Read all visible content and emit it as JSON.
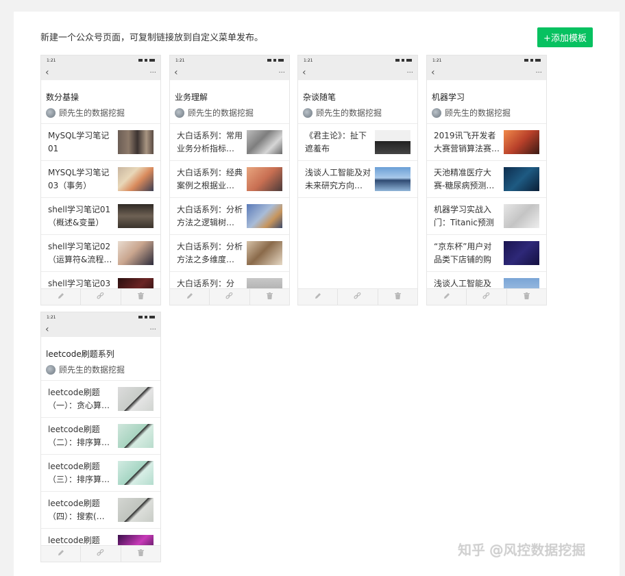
{
  "header": {
    "description": "新建一个公众号页面，可复制链接放到自定义菜单发布。",
    "add_button": "+添加模板"
  },
  "phone": {
    "time": "1:21",
    "back_icon": "‹",
    "more_icon": "···"
  },
  "toolbar": {
    "edit_icon": "pencil-icon",
    "link_icon": "link-icon",
    "delete_icon": "trash-icon"
  },
  "cards": [
    {
      "title": "数分基操",
      "author": "顾先生的数据挖掘",
      "articles": [
        {
          "text": "MySQL学习笔记01",
          "thumb": "linear-gradient(90deg,#6b5d55 0%,#8d7a6a 30%,#3b3230 55%,#a89582 80%,#5a4a42 100%)"
        },
        {
          "text": "MYSQL学习笔记03（事务）",
          "thumb": "linear-gradient(135deg,#c9b6a0 0%,#e8d7b8 35%,#d98a5c 60%,#3a3d52 100%)"
        },
        {
          "text": "shell学习笔记01（概述&变量）",
          "thumb": "linear-gradient(180deg,#2f2a25 0%,#6e6154 50%,#3a332c 100%)"
        },
        {
          "text": "shell学习笔记02（运算符&流程…",
          "thumb": "linear-gradient(135deg,#e9dcd0 0%,#c9a58e 45%,#2b2b3a 100%)"
        },
        {
          "text": "shell学习笔记03",
          "thumb": "linear-gradient(135deg,#2b1010 0%,#6a2525 50%,#1a0a0a 100%)"
        }
      ]
    },
    {
      "title": "业务理解",
      "author": "顾先生的数据挖掘",
      "articles": [
        {
          "text": "大白话系列：常用业务分析指标…",
          "thumb": "linear-gradient(135deg,#bdbdbd 0%,#7e7e7e 40%,#d6d6d6 70%,#6b6b6b 100%)"
        },
        {
          "text": "大白话系列：经典案例之根据业…",
          "thumb": "linear-gradient(135deg,#e8a57e 0%,#c86f52 50%,#4a3a3a 100%)"
        },
        {
          "text": "大白话系列：分析方法之逻辑树…",
          "thumb": "linear-gradient(135deg,#5a7ab8 0%,#a8bcd8 45%,#c7955c 70%,#3d4a6a 100%)"
        },
        {
          "text": "大白话系列：分析方法之多维度…",
          "thumb": "linear-gradient(135deg,#d6c2a8 0%,#8a6a4a 45%,#e6d8c4 100%)"
        },
        {
          "text": "大白话系列：分",
          "thumb": "linear-gradient(180deg,#c8c8c8 0%,#9a9a9a 100%)"
        }
      ]
    },
    {
      "title": "杂谈随笔",
      "author": "顾先生的数据挖掘",
      "articles": [
        {
          "text": "《君主论》：扯下遮羞布",
          "thumb": "linear-gradient(180deg,#f0f0f0 0%,#f0f0f0 45%,#222 46%,#444 100%)"
        },
        {
          "text": "浅谈人工智能及对未来研究方向…",
          "thumb": "linear-gradient(180deg,#6a9fd6 0%,#a9c9ea 45%,#2f4a72 55%,#8fb4d8 100%)"
        }
      ]
    },
    {
      "title": "机器学习",
      "author": "顾先生的数据挖掘",
      "articles": [
        {
          "text": "2019讯飞开发者大赛营销算法赛…",
          "thumb": "linear-gradient(135deg,#f08a4a 0%,#b8402a 50%,#3a1a14 100%)"
        },
        {
          "text": "天池精准医疗大赛-糖尿病预测…",
          "thumb": "linear-gradient(135deg,#0e2e4e 0%,#1e5a82 50%,#0a1e36 100%)"
        },
        {
          "text": "机器学习实战入门：Titanic预测",
          "thumb": "linear-gradient(135deg,#e6e6e6 0%,#c4c4c4 50%,#eeeeee 100%)"
        },
        {
          "text": "“京东杯”用户对品类下店铺的购买…",
          "thumb": "linear-gradient(135deg,#1a1450 0%,#2e2878 50%,#141040 100%)"
        },
        {
          "text": "浅谈人工智能及",
          "thumb": "linear-gradient(180deg,#7aa5d6 0%,#b5cde8 100%)"
        }
      ]
    },
    {
      "title": "leetcode刷题系列",
      "author": "顾先生的数据挖掘",
      "articles": [
        {
          "text": "leetcode刷题（一）：贪心算…",
          "thumb": "linear-gradient(135deg,#dcdcdc 0%,#c8ccc8 50%,#2a2a2a 51%,#e4e4e4 60%,#d0d4d0 100%)"
        },
        {
          "text": "leetcode刷题（二）：排序算…",
          "thumb": "linear-gradient(135deg,#cfe6dc 0%,#a8d4c0 50%,#2a2a2a 51%,#d6ece2 60%,#b8dccc 100%)"
        },
        {
          "text": "leetcode刷题（三）：排序算…",
          "thumb": "linear-gradient(135deg,#d2ebe2 0%,#a6d6c4 50%,#2a2a2a 51%,#d8eee6 60%,#b4ddce 100%)"
        },
        {
          "text": "leetcode刷题（四）：搜索(…",
          "thumb": "linear-gradient(135deg,#d4d6d2 0%,#c0c4be 50%,#2a2a2a 51%,#dcdedA 60%,#c8ccc6 100%)"
        },
        {
          "text": "leetcode刷题",
          "thumb": "linear-gradient(135deg,#3a0e4a 0%,#c83ab8 50%,#2a0a3a 100%)"
        }
      ]
    }
  ],
  "watermark": "知乎 @风控数据挖掘"
}
